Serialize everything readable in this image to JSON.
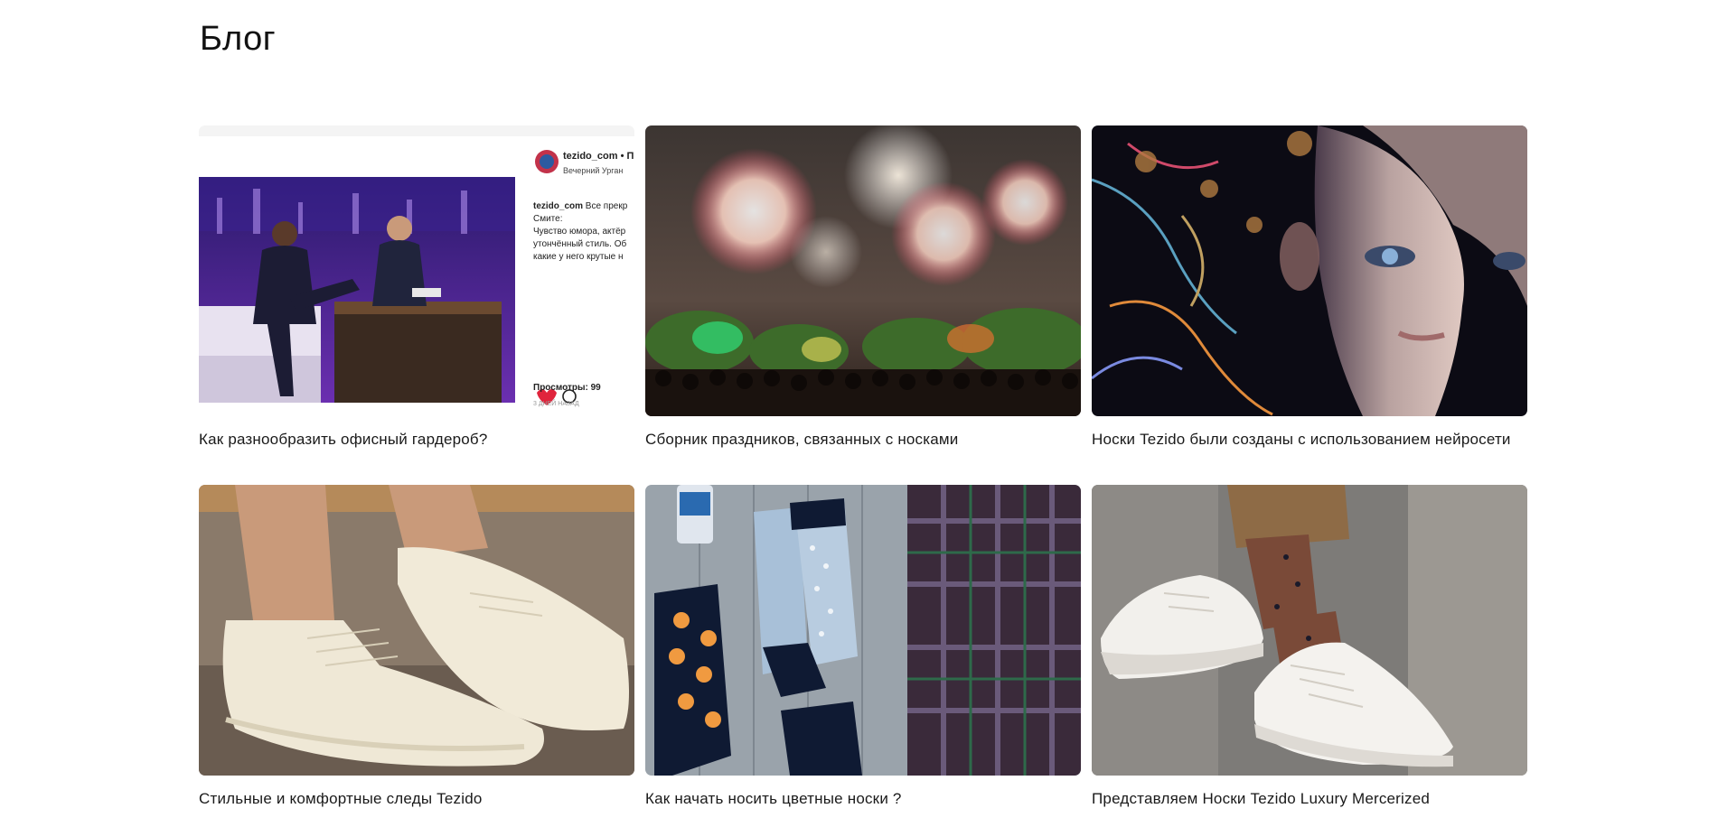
{
  "page": {
    "title": "Блог"
  },
  "posts": [
    {
      "title": "Как разнообразить офисный гардероб?",
      "image": "talk-show-instagram-screenshot",
      "overlay": {
        "username": "tezido_com • П",
        "subtitle": "Вечерний Урган",
        "caption_user": "tezido_com",
        "caption_lines": [
          "Все прекр",
          "Смите:",
          "Чувство юмора, актёр",
          "утончённый стиль. Об",
          "какие у него крутые н"
        ],
        "views": "Просмотры: 99",
        "time_ago": "3 ДНЕЙ НАЗАД"
      }
    },
    {
      "title": "Сборник праздников, связанных с носками",
      "image": "fireworks-over-crowd"
    },
    {
      "title": "Носки Tezido были созданы с использованием нейросети",
      "image": "ai-art-face"
    },
    {
      "title": "Стильные и комфортные следы Tezido",
      "image": "white-sneakers-ankle-socks"
    },
    {
      "title": "Как начать носить цветные носки ?",
      "image": "socks-flatlay-plaid-shirt"
    },
    {
      "title": "Представляем Носки Tezido Luxury Mercerized",
      "image": "white-sneakers-dotted-socks"
    }
  ],
  "colors": {
    "background": "#ffffff",
    "text": "#111111",
    "like": "#e0243c"
  }
}
